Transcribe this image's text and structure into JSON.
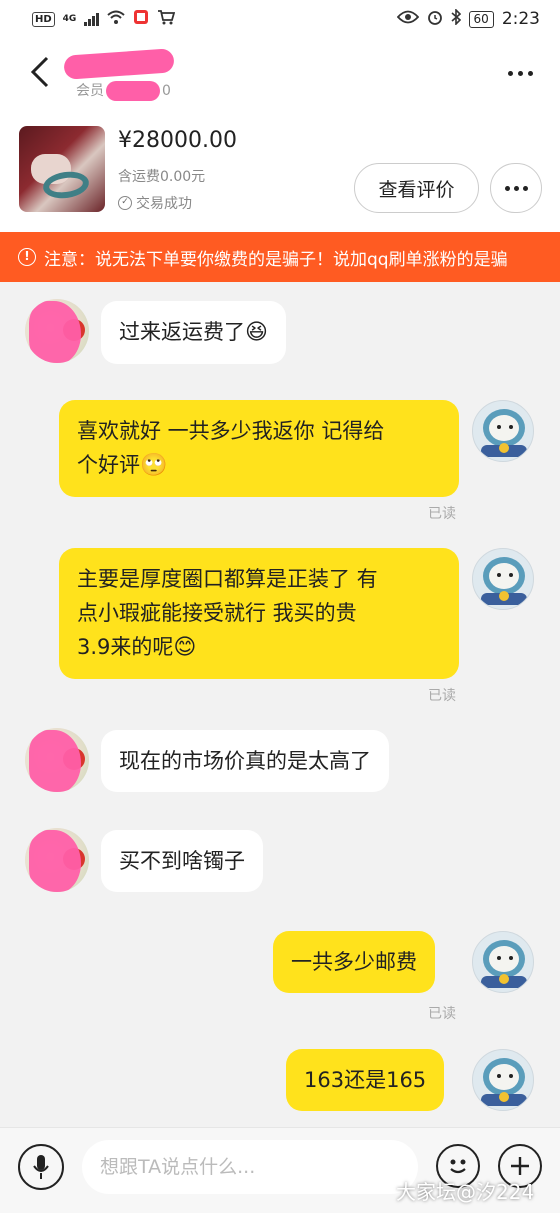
{
  "status_bar": {
    "left_badges": [
      "HD",
      "4G"
    ],
    "time": "2:23",
    "battery": "60"
  },
  "header": {
    "member_label": "会员",
    "member_suffix": "0"
  },
  "product": {
    "price": "¥28000.00",
    "shipping": "含运费0.00元",
    "status": "交易成功",
    "review_button": "查看评价"
  },
  "notice": {
    "text": "注意：说无法下单要你缴费的是骗子！说加qq刷单涨粉的是骗"
  },
  "messages": [
    {
      "side": "in",
      "text": "过来返运费了",
      "emoji": "😆"
    },
    {
      "side": "out",
      "lines": [
        "喜欢就好 一共多少我返你 记得给",
        "个好评"
      ],
      "emoji": "🙄",
      "read": "已读"
    },
    {
      "side": "out",
      "lines": [
        "主要是厚度圈口都算是正装了 有",
        "点小瑕疵能接受就行 我买的贵",
        "3.9来的呢"
      ],
      "emoji": "😊",
      "read": "已读"
    },
    {
      "side": "in",
      "text": "现在的市场价真的是太高了"
    },
    {
      "side": "in",
      "text": "买不到啥镯子"
    },
    {
      "side": "out",
      "text": "一共多少邮费",
      "read": "已读"
    },
    {
      "side": "out",
      "text": "163还是165"
    }
  ],
  "input": {
    "placeholder": "想跟TA说点什么..."
  },
  "watermark": "大家坛@汐224",
  "colors": {
    "notice_bg": "#ff5b22",
    "outgoing_bubble": "#ffe21c",
    "incoming_bubble": "#ffffff",
    "background": "#f2f2f2",
    "redaction": "#ff5fa8"
  }
}
